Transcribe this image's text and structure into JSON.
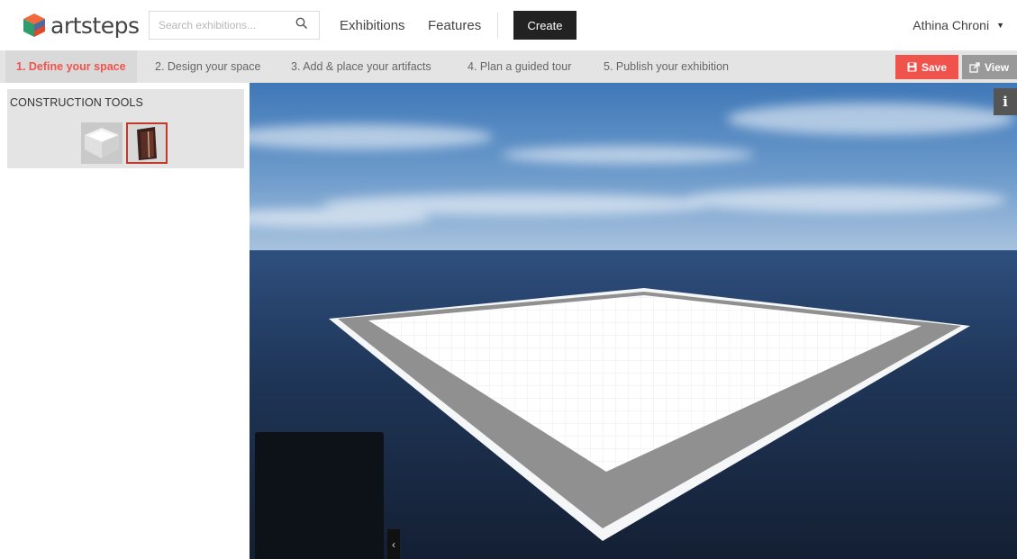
{
  "brand": {
    "name": "artsteps"
  },
  "search": {
    "placeholder": "Search exhibitions..."
  },
  "nav": {
    "exhibitions": "Exhibitions",
    "features": "Features",
    "create": "Create"
  },
  "user": {
    "name": "Athina Chroni"
  },
  "steps": [
    {
      "label": "1. Define your space",
      "active": true
    },
    {
      "label": "2. Design your space",
      "active": false
    },
    {
      "label": "3. Add & place your artifacts",
      "active": false
    },
    {
      "label": "4. Plan a guided tour",
      "active": false
    },
    {
      "label": "5. Publish your exhibition",
      "active": false
    }
  ],
  "actions": {
    "save": "Save",
    "view": "View"
  },
  "tools": {
    "title": "CONSTRUCTION TOOLS"
  },
  "viewport": {
    "info": "i"
  },
  "minimap": {
    "collapse": "‹"
  },
  "colors": {
    "accent": "#f0534c",
    "dark": "#222222",
    "stepbar": "#e4e4e4"
  }
}
